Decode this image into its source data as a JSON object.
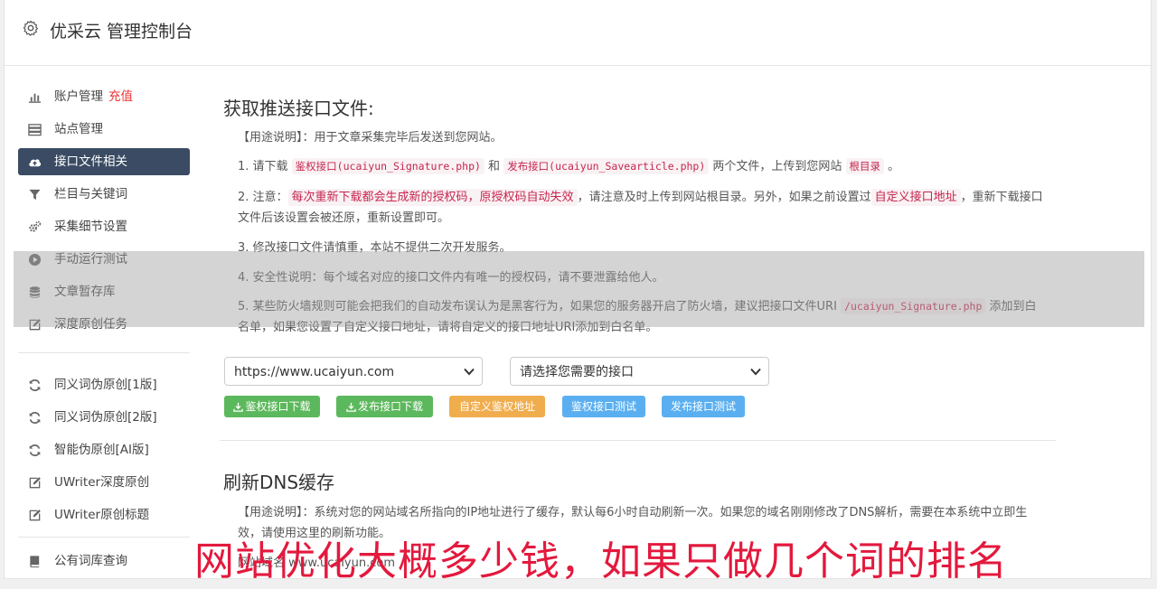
{
  "header": {
    "title": "优采云 管理控制台"
  },
  "sidebar": {
    "items": [
      {
        "label": "账户管理",
        "extra": "充值",
        "icon": "bar-chart-icon"
      },
      {
        "label": "站点管理",
        "icon": "server-icon"
      },
      {
        "label": "接口文件相关",
        "icon": "cloud-upload-icon",
        "active": true
      },
      {
        "label": "栏目与关键词",
        "icon": "filter-icon"
      },
      {
        "label": "采集细节设置",
        "icon": "cogs-icon"
      },
      {
        "label": "手动运行测试",
        "icon": "play-circle-icon"
      },
      {
        "label": "文章暂存库",
        "icon": "database-icon"
      },
      {
        "label": "深度原创任务",
        "icon": "edit-icon"
      }
    ],
    "items2": [
      {
        "label": "同义词伪原创[1版]",
        "icon": "refresh-icon"
      },
      {
        "label": "同义词伪原创[2版]",
        "icon": "refresh-icon"
      },
      {
        "label": "智能伪原创[AI版]",
        "icon": "refresh-icon"
      },
      {
        "label": "UWriter深度原创",
        "icon": "edit-icon"
      },
      {
        "label": "UWriter原创标题",
        "icon": "edit-icon"
      }
    ],
    "items3": [
      {
        "label": "公有词库查询",
        "icon": "book-icon"
      }
    ]
  },
  "section1": {
    "heading": "获取推送接口文件:",
    "usage": "【用途说明】：用于文章采集完毕后发送到您网站。",
    "p1": {
      "a": "1. 请下载 ",
      "code1": "鉴权接口(ucaiyun_Signature.php)",
      "b": " 和 ",
      "code2": "发布接口(ucaiyun_Savearticle.php)",
      "c": " 两个文件，上传到您网站 ",
      "code3": "根目录",
      "d": " 。"
    },
    "p2": {
      "a": "2. 注意：",
      "hl1": "每次重新下载都会生成新的授权码，原授权码自动失效",
      "b": "，请注意及时上传到网站根目录。另外，如果之前设置过",
      "hl2": "自定义接口地址",
      "c": "，重新下载接口文件后该设置会被还原，重新设置即可。"
    },
    "p3": "3. 修改接口文件请慎重，本站不提供二次开发服务。",
    "p4": "4. 安全性说明：每个域名对应的接口文件内有唯一的授权码，请不要泄露给他人。",
    "p5": {
      "a": "5. 某些防火墙规则可能会把我们的自动发布误认为是黑客行为，如果您的服务器开启了防火墙，建议把接口文件URI ",
      "code1": "/ucaiyun_Signature.php",
      "b": " 添加到白名单，如果您设置了自定义接口地址，请将自定义的接口地址URI添加到白名单。"
    },
    "site_select": "https://www.ucaiyun.com",
    "api_select": "请选择您需要的接口",
    "buttons": {
      "download_auth": "鉴权接口下载",
      "download_publish": "发布接口下载",
      "custom_auth_url": "自定义鉴权地址",
      "test_auth": "鉴权接口测试",
      "test_publish": "发布接口测试"
    }
  },
  "section2": {
    "heading": "刷新DNS缓存",
    "usage": "【用途说明】：系统对您的网站域名所指向的IP地址进行了缓存，默认每6小时自动刷新一次。如果您的域名刚刚修改了DNS解析，需要在本系统中立即生效，请使用这里的刷新功能。",
    "partial": "网站域名 www.ucaiyun.com"
  },
  "banner": {
    "text": "网站优化大概多少钱，如果只做几个词的排名"
  },
  "colors": {
    "active_nav": "#3a4b63",
    "green": "#5cb85c",
    "orange": "#f0ad4e",
    "blue": "#5aaff0",
    "banner": "#e3193d",
    "code": "#c7254e"
  }
}
